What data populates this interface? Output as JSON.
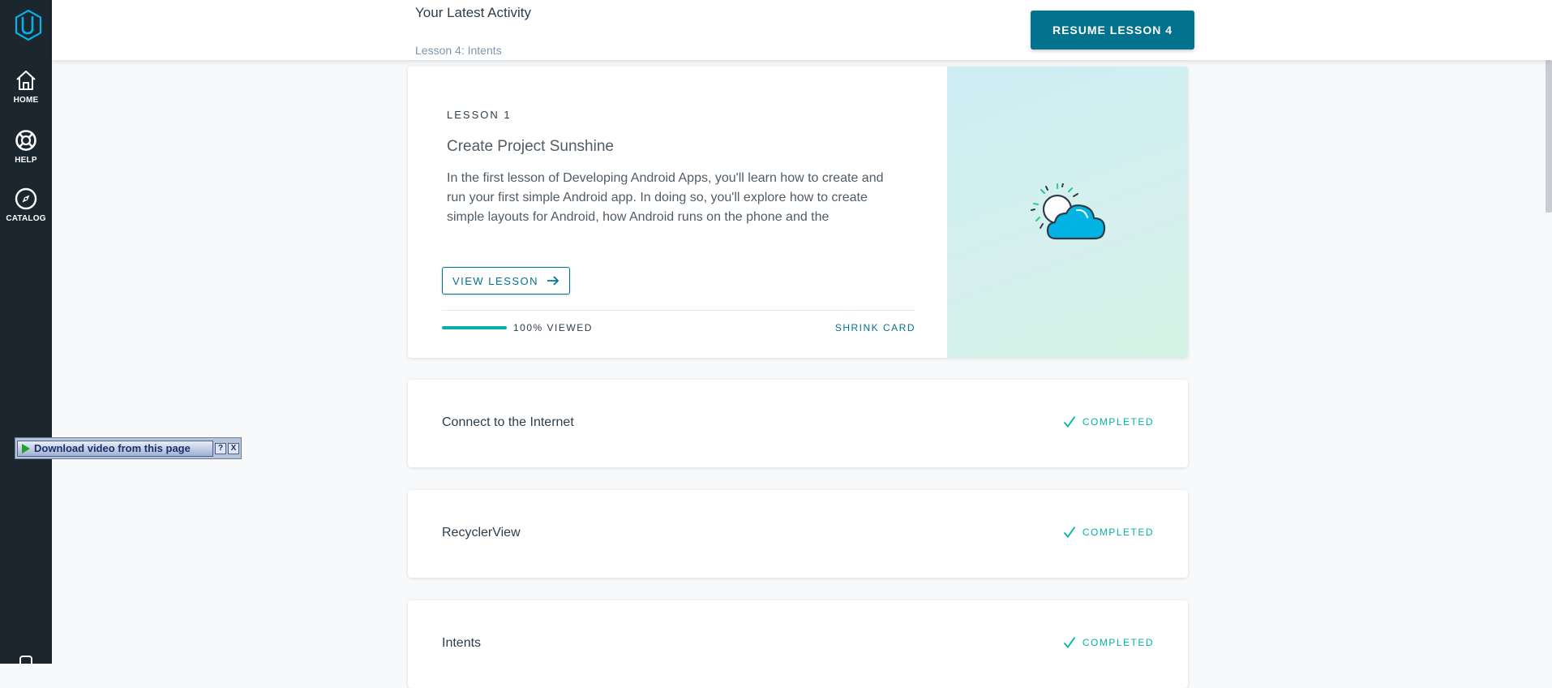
{
  "sidebar": {
    "items": [
      {
        "label": "HOME",
        "icon": "home-icon"
      },
      {
        "label": "HELP",
        "icon": "lifebuoy-icon"
      },
      {
        "label": "CATALOG",
        "icon": "compass-icon"
      }
    ]
  },
  "header": {
    "title": "Your Latest Activity",
    "subtitle": "Lesson 4: Intents",
    "resume_label": "RESUME LESSON 4"
  },
  "lesson_card": {
    "kicker": "LESSON 1",
    "title": "Create Project Sunshine",
    "description": "In the first lesson of Developing Android Apps, you'll learn how to create and run your first simple Android app. In doing so, you'll explore how to create simple layouts for Android, how Android runs on the phone and the",
    "view_label": "VIEW LESSON",
    "progress_fraction": 1.0,
    "progress_label": "100% VIEWED",
    "shrink_label": "SHRINK CARD",
    "art_icon": "sun-cloud-icon"
  },
  "lessons": [
    {
      "title": "Connect to the Internet",
      "status": "COMPLETED"
    },
    {
      "title": "RecyclerView",
      "status": "COMPLETED"
    },
    {
      "title": "Intents",
      "status": "COMPLETED"
    }
  ],
  "download_widget": {
    "label": "Download video from this page",
    "help": "?",
    "close": "X"
  },
  "colors": {
    "sidebar": "#1c262f",
    "brand": "#02728f",
    "success": "#02b3a4",
    "logo": "#02b3e4"
  }
}
